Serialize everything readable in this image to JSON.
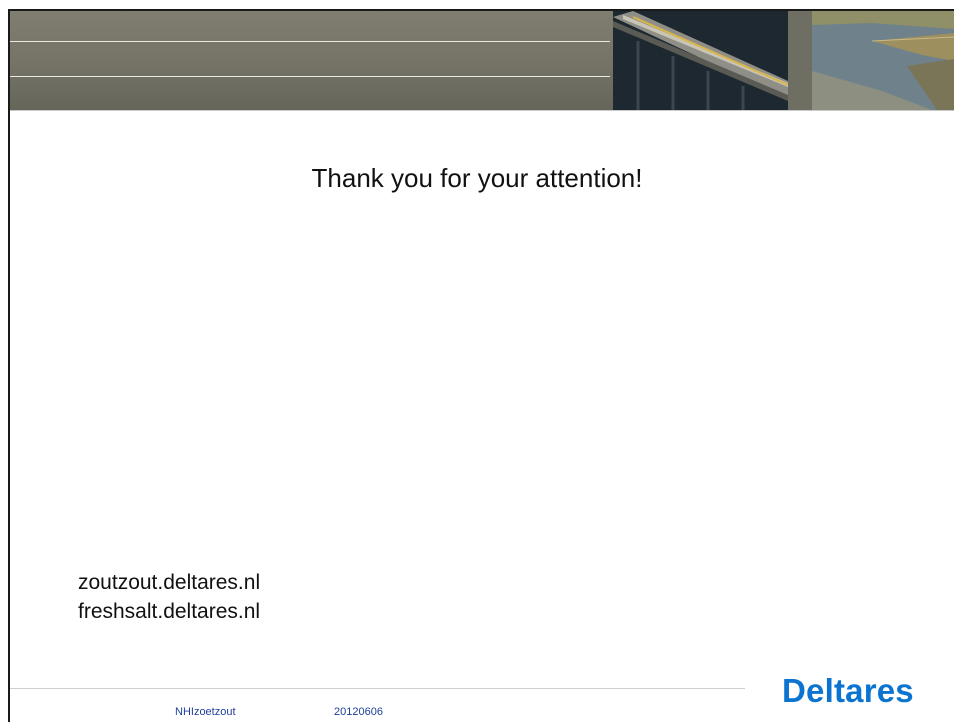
{
  "slide": {
    "title": "Thank you for your attention!",
    "links": [
      "zoutzout.deltares.nl",
      "freshsalt.deltares.nl"
    ],
    "footer": {
      "project": "NHIzoetzout",
      "date": "20120606"
    },
    "logo_text": "Deltares"
  },
  "colors": {
    "banner": "#747366",
    "logo": "#0b74d0",
    "footer_text": "#1f3f99"
  },
  "icons": [
    "bridge-photo",
    "river-aerial-photo"
  ]
}
